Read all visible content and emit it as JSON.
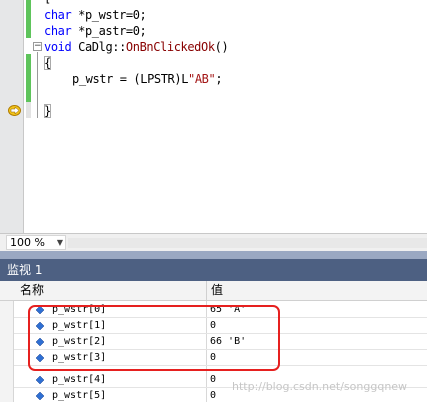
{
  "editor": {
    "code_lines": [
      {
        "type": "char",
        "rest": " *p_wstr=0;"
      },
      {
        "type": "char",
        "rest": " *p_astr=0;"
      }
    ],
    "func_decl": {
      "kw": "void",
      "class": "CaDlg",
      "sep": "::",
      "fn": "OnBnClickedOk",
      "args": "()"
    },
    "open_brace": "{",
    "assign": {
      "lhs": "p_wstr = (LPSTR)L",
      "str": "\"AB\"",
      "end": ";"
    },
    "close_brace": "}",
    "outline_toggle": "−"
  },
  "zoom": {
    "value": "100 %"
  },
  "watch": {
    "title": "监视 1",
    "col_name": "名称",
    "col_value": "值",
    "rows": [
      {
        "name": "p_wstr[0]",
        "value": "65 'A'"
      },
      {
        "name": "p_wstr[1]",
        "value": "0"
      },
      {
        "name": "p_wstr[2]",
        "value": "66 'B'"
      },
      {
        "name": "p_wstr[3]",
        "value": "0"
      },
      {
        "name": "p_wstr[4]",
        "value": "0"
      },
      {
        "name": "p_wstr[5]",
        "value": "0"
      }
    ]
  },
  "watermark": "http://blog.csdn.net/songgqnew",
  "colors": {
    "title_bar": "#4d6082",
    "change_bar": "#5ec45b",
    "highlight": "#e6201f",
    "keyword": "#0000ff"
  }
}
